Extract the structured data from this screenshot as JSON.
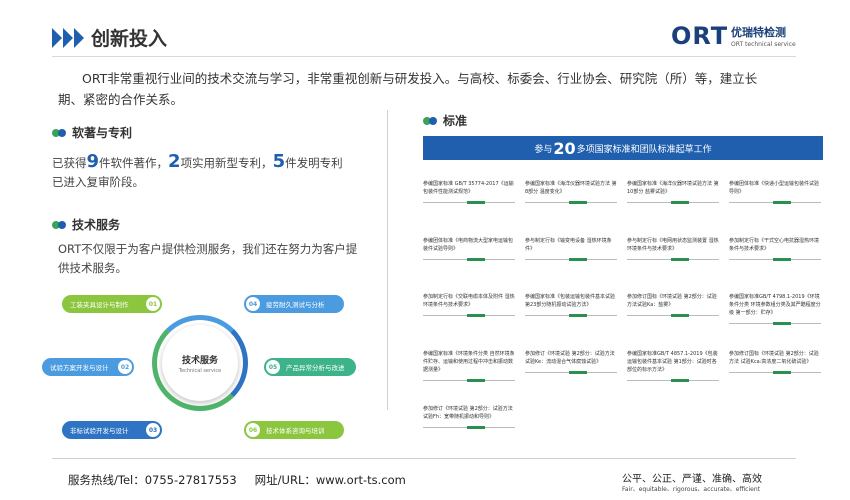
{
  "header": {
    "title": "创新投入"
  },
  "logo": {
    "mark": "ORT",
    "cn": "优瑞特检测",
    "en": "ORT technical service"
  },
  "intro": "ORT非常重视行业间的技术交流与学习，非常重视创新与研发投入。与高校、标委会、行业协会、研究院（所）等，建立长期、紧密的合作关系。",
  "software": {
    "title": "软著与专利",
    "l1_a": "已获得",
    "n1": "9",
    "l1_b": "件软件著作，",
    "n2": "2",
    "l1_c": "项实用新型专利，",
    "n3": "5",
    "l1_d": "件发明专利",
    "line2": "已进入复审阶段。"
  },
  "service": {
    "title": "技术服务",
    "text": "ORT不仅限于为客户提供检测服务，我们还在努力为客户提供技术服务。",
    "hub_cn": "技术服务",
    "hub_en": "Technical service",
    "items": [
      {
        "num": "01",
        "label": "工装夹具设计与制作"
      },
      {
        "num": "02",
        "label": "试验方案开发与设计"
      },
      {
        "num": "03",
        "label": "非标试验开发与设计"
      },
      {
        "num": "04",
        "label": "疲劳耐久测试与分析"
      },
      {
        "num": "05",
        "label": "产品异常分析与改进"
      },
      {
        "num": "06",
        "label": "技术体系咨询与培训"
      }
    ]
  },
  "standards": {
    "title": "标准",
    "banner_pre": "参与",
    "banner_num": "20",
    "banner_post": "多项国家标准和团队标准起草工作",
    "items": [
      "参编国家标准 GB/T 35774-2017《运输包装件性能测试规范》",
      "参编国家标准《海洋仪器环境试验方法 第8部分 温度变化》",
      "参编国家标准《海洋仪器环境试验方法 第10部分 盐雾试验》",
      "参编团体标准《快递小型运输包装件试验导则》",
      "参编团体标准《电商物流大型家电运输包装件试验导则》",
      "参与制定行标《输变电设备 湿热环境条件》",
      "参与制定行标《电网用状态监测装置 湿热环境条件与技术要求》",
      "参加制定行标《干式空心电抗器湿热环境条件与技术要求》",
      "参加制定行标《交联电缆本体及附件 湿热环境条件与技术要求》",
      "参编国家标准《包装运输包装件基本试验第23部分随机振动试验方法》",
      "参加修订国标《环境试验 第2部分：试验方法试验Ka：盐雾》",
      "参编国家标准GB/T 4798.1-2019《环境条件分类 环境参数组分类及其严酷程度分级 第一部分：贮存》",
      "参编国家标准《环境条件分类 自然环境条件贮存、运输和使用过程中冲击和振动数据测量》",
      "参加修订《环境试验 第2部分：试验方法 试验Ke：流动混合气体腐蚀试验》",
      "参编国家标准GB/T 4857.1-2019《包装 运输包装件基本试验 第1部分：试验时各部位的标示方法》",
      "参加修订国标《环境试验 第2部分：试验方法 试验Kca:高浓度二氧化硫试验》",
      "参加修订《环境试验 第2部分：试验方法 试验Fh：宽带随机振动和导则》"
    ]
  },
  "footer": {
    "hotline": "服务热线/Tel：0755-27817553",
    "url": "网址/URL：www.ort-ts.com",
    "slogan_cn": "公平、公正、严谨、准确、高效",
    "slogan_en": "Fair、equitable、rigorous、accurate、efficient"
  },
  "colors": {
    "primary": "#1f5fae",
    "green": "#3aa35a"
  }
}
